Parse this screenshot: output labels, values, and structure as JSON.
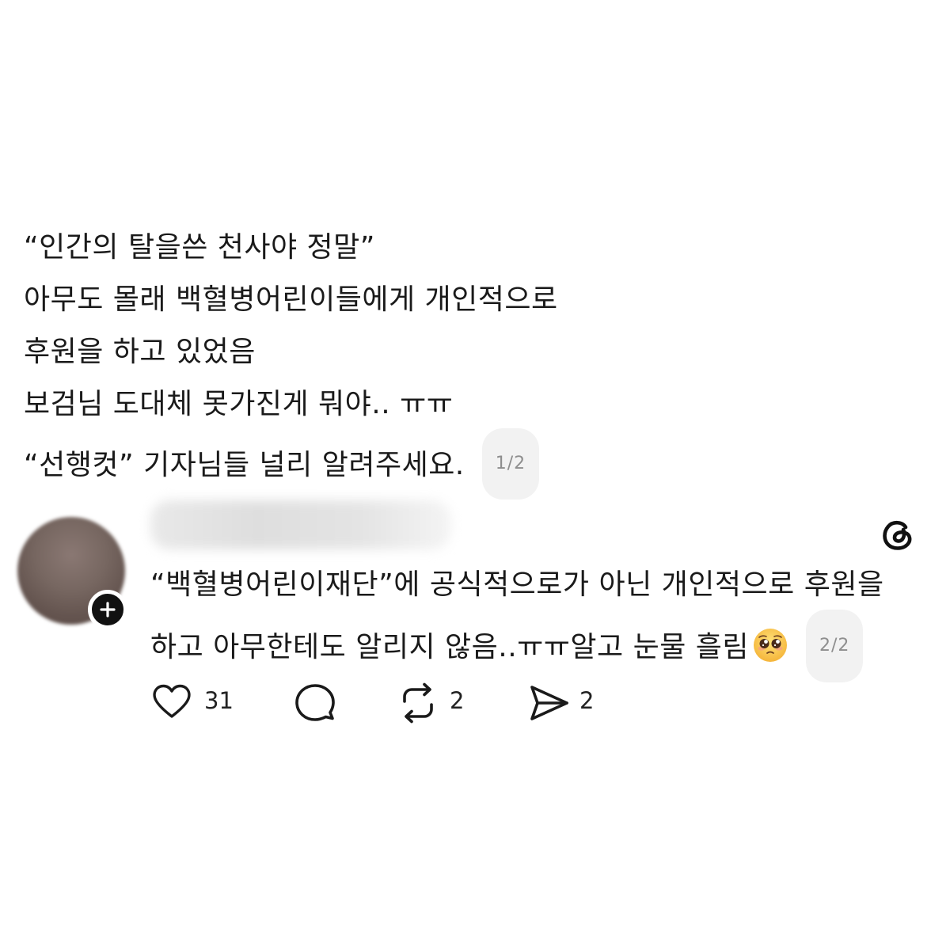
{
  "post1": {
    "lines": [
      "“인간의 탈을쓴 천사야 정말”",
      "아무도 몰래 백혈병어린이들에게 개인적으로",
      "후원을 하고 있었음",
      "보검님 도대체 못가진게 뭐야.. ㅠㅠ",
      "“선행컷” 기자님들 널리 알려주세요."
    ],
    "counter": "1/2"
  },
  "post2": {
    "lines": [
      "“백혈병어린이재단”에 공식적으로가 아닌 개인적으로 후원을",
      "하고 아무한테도 알리지 않음..ㅠㅠ알고 눈물 흘림"
    ],
    "emoji": "pleading-face-emoji",
    "counter": "2/2"
  },
  "actions": {
    "like_count": "31",
    "repost_count": "2",
    "share_count": "2"
  },
  "icons": {
    "like": "heart-icon",
    "reply": "comment-bubble-icon",
    "repost": "repost-icon",
    "share": "send-icon",
    "brand": "threads-logo-icon",
    "follow": "plus-icon"
  },
  "colors": {
    "text": "#1a1a1a",
    "counter_bg": "#f2f2f2",
    "counter_text": "#8e8e8e",
    "avatar_badge": "#111111"
  }
}
